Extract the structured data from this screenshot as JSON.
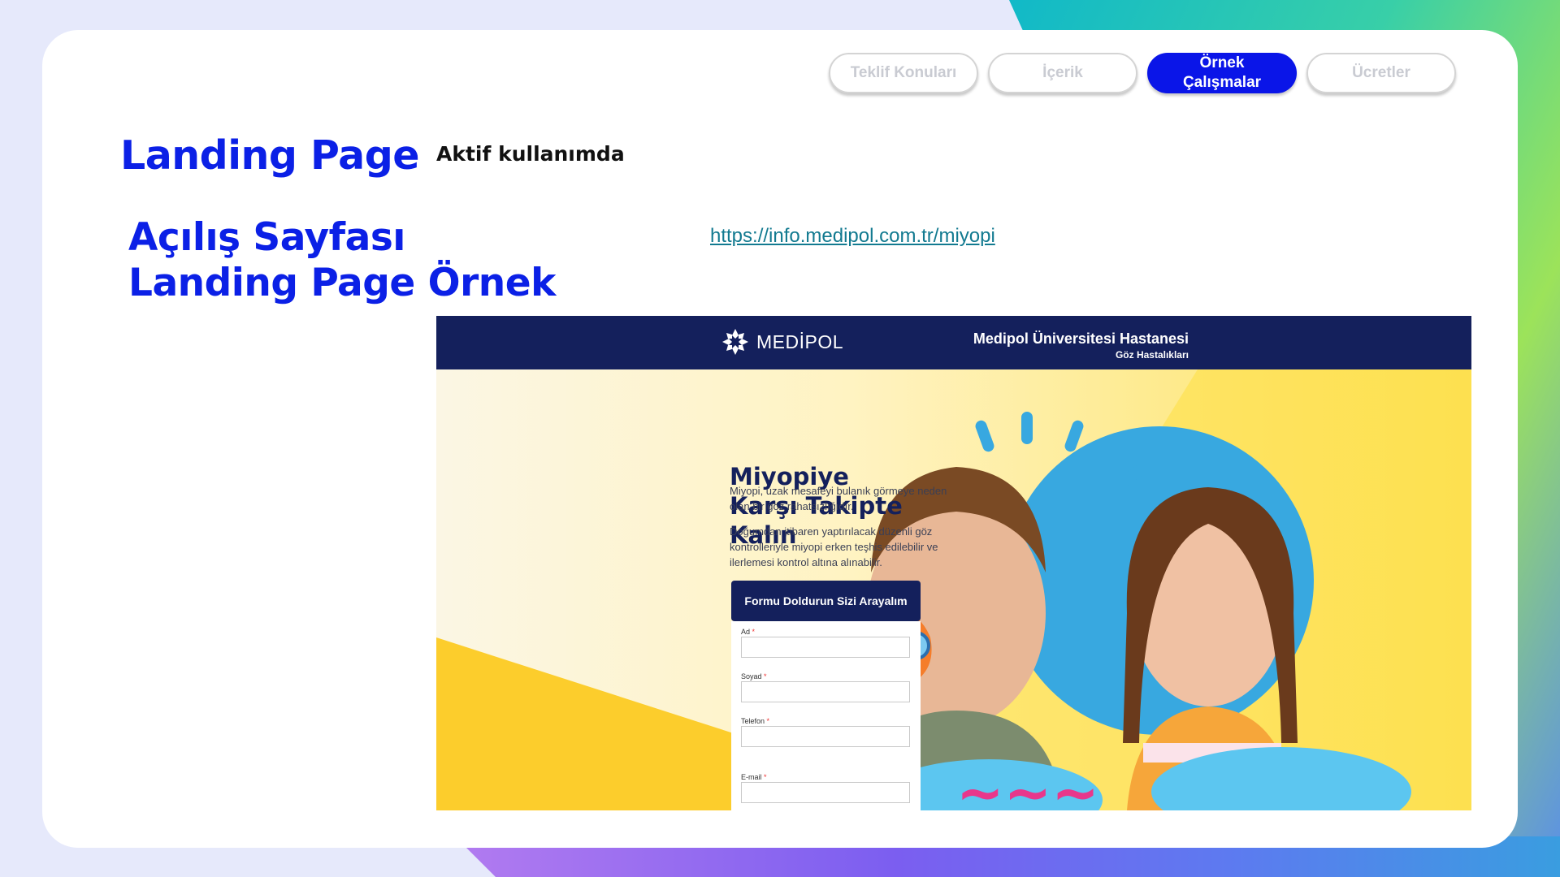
{
  "tabs": [
    {
      "label": "Teklif Konuları"
    },
    {
      "label": "İçerik"
    },
    {
      "label": "Örnek Çalışmalar"
    },
    {
      "label": "Ücretler"
    }
  ],
  "active_tab": "Örnek Çalışmalar",
  "title": "Landing Page",
  "status": "Aktif kullanımda",
  "subtitle": "Açılış Sayfası Landing Page Örnek",
  "url": "https://info.medipol.com.tr/miyopi",
  "colors": {
    "primary_blue": "#0b20e6",
    "navy": "#14205c",
    "link_teal": "#127a90",
    "yellow": "#fde047"
  },
  "landing": {
    "logo_text": "MEDİPOL",
    "hospital_name": "Medipol Üniversitesi Hastanesi",
    "department": "Göz Hastalıkları",
    "headline": "Miyopiye Karşı Takipte Kalın",
    "para1": "Miyopi, uzak mesafeyi bulanık görmeye neden olan bir göz rahatsızlığıdır.",
    "para2": "Doğumdan itibaren yaptırılacak düzenli göz kontrolleriyle miyopi erken teşhis edilebilir ve ilerlemesi kontrol altına alınabilir.",
    "form_title": "Formu Doldurun Sizi Arayalım",
    "fields": [
      {
        "label": "Ad"
      },
      {
        "label": "Soyad"
      },
      {
        "label": "Telefon"
      },
      {
        "label": "E-mail"
      }
    ]
  }
}
